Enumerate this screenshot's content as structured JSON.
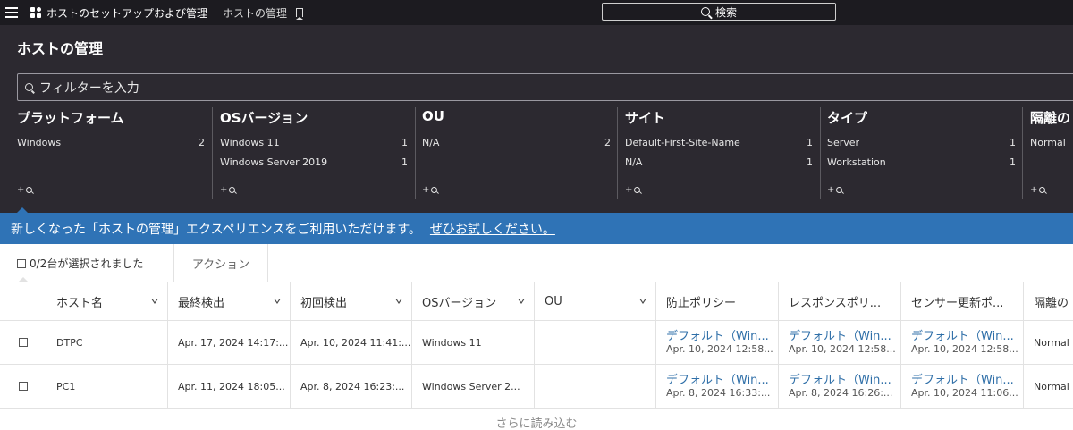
{
  "topbar": {
    "app_title": "ホストのセットアップおよび管理",
    "page_crumb": "ホストの管理",
    "search_label": "検索"
  },
  "panel": {
    "title": "ホストの管理",
    "filter_placeholder": "フィルターを入力",
    "facets": [
      {
        "title": "プラットフォーム",
        "rows": [
          {
            "label": "Windows",
            "count": "2"
          }
        ],
        "more": "+"
      },
      {
        "title": "OSバージョン",
        "rows": [
          {
            "label": "Windows 11",
            "count": "1"
          },
          {
            "label": "Windows Server 2019",
            "count": "1"
          }
        ],
        "more": "+"
      },
      {
        "title": "OU",
        "rows": [
          {
            "label": "N/A",
            "count": "2"
          }
        ],
        "more": "+"
      },
      {
        "title": "サイト",
        "rows": [
          {
            "label": "Default-First-Site-Name",
            "count": "1"
          },
          {
            "label": "N/A",
            "count": "1"
          }
        ],
        "more": "+"
      },
      {
        "title": "タイプ",
        "rows": [
          {
            "label": "Server",
            "count": "1"
          },
          {
            "label": "Workstation",
            "count": "1"
          }
        ],
        "more": "+"
      },
      {
        "title": "隔離の",
        "rows": [
          {
            "label": "Normal",
            "count": ""
          }
        ],
        "more": "+"
      }
    ]
  },
  "banner": {
    "message": "新しくなった「ホストの管理」エクスペリエンスをご利用いただけます。",
    "link": "ぜひお試しください。"
  },
  "actionbar": {
    "selected": "0/2台が選択されました",
    "action_label": "アクション"
  },
  "table": {
    "columns": [
      "ホスト名",
      "最終検出",
      "初回検出",
      "OSバージョン",
      "OU",
      "防止ポリシー",
      "レスポンスポリ...",
      "センサー更新ポ...",
      "隔離の"
    ],
    "rows": [
      {
        "host": "DTPC",
        "last_seen": "Apr. 17, 2024 14:17:...",
        "first_seen": "Apr. 10, 2024 11:41:...",
        "os": "Windows 11",
        "ou": "",
        "prevention": {
          "name": "デフォルト（Win...",
          "date": "Apr. 10, 2024 12:58..."
        },
        "response": {
          "name": "デフォルト（Win...",
          "date": "Apr. 10, 2024 12:58..."
        },
        "sensor": {
          "name": "デフォルト（Win...",
          "date": "Apr. 10, 2024 12:58..."
        },
        "containment": "Normal"
      },
      {
        "host": "PC1",
        "last_seen": "Apr. 11, 2024 18:05...",
        "first_seen": "Apr. 8, 2024 16:23:...",
        "os": "Windows Server 2...",
        "ou": "",
        "prevention": {
          "name": "デフォルト（Win...",
          "date": "Apr. 8, 2024 16:33:..."
        },
        "response": {
          "name": "デフォルト（Win...",
          "date": "Apr. 8, 2024 16:26:..."
        },
        "sensor": {
          "name": "デフォルト（Win...",
          "date": "Apr. 10, 2024 11:06..."
        },
        "containment": "Normal"
      }
    ],
    "load_more": "さらに読み込む"
  }
}
